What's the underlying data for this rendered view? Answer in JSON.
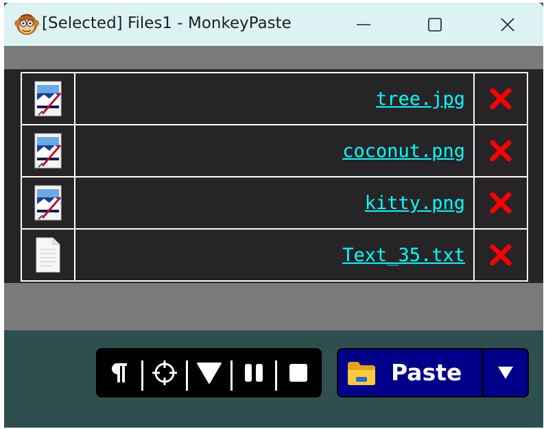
{
  "window": {
    "title": "[Selected] Files1 - MonkeyPaste",
    "app_icon": "monkey-icon",
    "controls": [
      "minimize-icon",
      "maximize-icon",
      "close-icon"
    ]
  },
  "files": [
    {
      "name": "tree.jpg",
      "icon": "image-file-icon"
    },
    {
      "name": "coconut.png",
      "icon": "image-file-icon"
    },
    {
      "name": "kitty.png",
      "icon": "image-file-icon"
    },
    {
      "name": "Text_35.txt",
      "icon": "text-file-icon"
    }
  ],
  "toolbar": {
    "icons": [
      "pilcrow-icon",
      "crosshair-icon",
      "triangle-down-icon",
      "pause-icon",
      "stop-icon"
    ]
  },
  "paste": {
    "label": "Paste",
    "icon": "folder-icon",
    "dropdown_icon": "triangle-down-icon"
  },
  "colors": {
    "titlebar": "#ddf3f3",
    "list_background": "#262426",
    "link": "#00ffff",
    "delete": "#ff0000",
    "footer": "#2f4f4f",
    "paste_button": "#00008b"
  }
}
